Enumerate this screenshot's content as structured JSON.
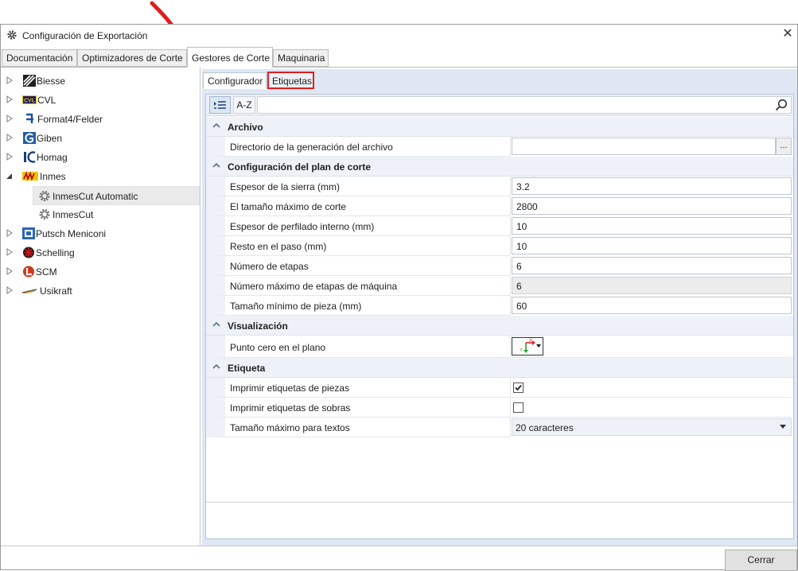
{
  "window": {
    "title": "Configuración de Exportación",
    "close_symbol": "✕"
  },
  "main_tabs": [
    "Documentación",
    "Optimizadores de Corte",
    "Gestores de Corte",
    "Maquinaria"
  ],
  "tree": {
    "items": [
      {
        "label": "Biesse",
        "expander": "collapsed",
        "icon": "biesse-logo"
      },
      {
        "label": "CVL",
        "expander": "collapsed",
        "icon": "cvl-logo"
      },
      {
        "label": "Format4/Felder",
        "expander": "collapsed",
        "icon": "format4-logo"
      },
      {
        "label": "Giben",
        "expander": "collapsed",
        "icon": "giben-logo"
      },
      {
        "label": "Homag",
        "expander": "collapsed",
        "icon": "homag-logo"
      },
      {
        "label": "Inmes",
        "expander": "expanded",
        "icon": "inmes-logo"
      },
      {
        "label": "InmesCut Automatic",
        "icon": "gear-icon",
        "selected": true
      },
      {
        "label": "InmesCut",
        "icon": "gear-icon"
      },
      {
        "label": "Putsch Meniconi",
        "expander": "collapsed",
        "icon": "putsch-logo"
      },
      {
        "label": "Schelling",
        "expander": "collapsed",
        "icon": "schelling-logo"
      },
      {
        "label": "SCM",
        "expander": "collapsed",
        "icon": "scm-logo"
      },
      {
        "label": "Usikraft",
        "expander": "collapsed",
        "icon": "usikraft-logo"
      }
    ]
  },
  "inner_tabs": [
    "Configurador",
    "Etiquetas"
  ],
  "toolbar": {
    "sort_az_label": "A-Z",
    "search_placeholder": "",
    "search_value": ""
  },
  "grid": {
    "archivo": {
      "title": "Archivo",
      "directorio": {
        "label": "Directorio de la generación del archivo",
        "value": "",
        "browse": "..."
      }
    },
    "plan": {
      "title": "Configuración del plan de corte",
      "rows": [
        {
          "label": "Espesor de la sierra (mm)",
          "value": "3.2"
        },
        {
          "label": "El tamaño máximo de corte",
          "value": "2800"
        },
        {
          "label": "Espesor de perfilado interno (mm)",
          "value": "10"
        },
        {
          "label": "Resto en el paso (mm)",
          "value": "10"
        },
        {
          "label": "Número de etapas",
          "value": "6"
        },
        {
          "label": "Número máximo de etapas de máquina",
          "value": "6",
          "readonly": true
        },
        {
          "label": "Tamaño mínimo de pieza (mm)",
          "value": "60"
        }
      ]
    },
    "visualizacion": {
      "title": "Visualización",
      "punto_cero": {
        "label": "Punto cero en el plano",
        "axis_x": "X",
        "axis_y": "Y"
      }
    },
    "etiqueta": {
      "title": "Etiqueta",
      "imprimir_piezas": {
        "label": "Imprimir etiquetas de piezas",
        "checked": true
      },
      "imprimir_sobras": {
        "label": "Imprimir etiquetas de sobras",
        "checked": false
      },
      "tamano_textos": {
        "label": "Tamaño máximo para textos",
        "value": "20 caracteres"
      }
    }
  },
  "footer": {
    "close_label": "Cerrar"
  },
  "colors": {
    "accent_red": "#e01e1e",
    "grid_header": "#eef2f8",
    "pane_bg": "#dfe7f3"
  }
}
